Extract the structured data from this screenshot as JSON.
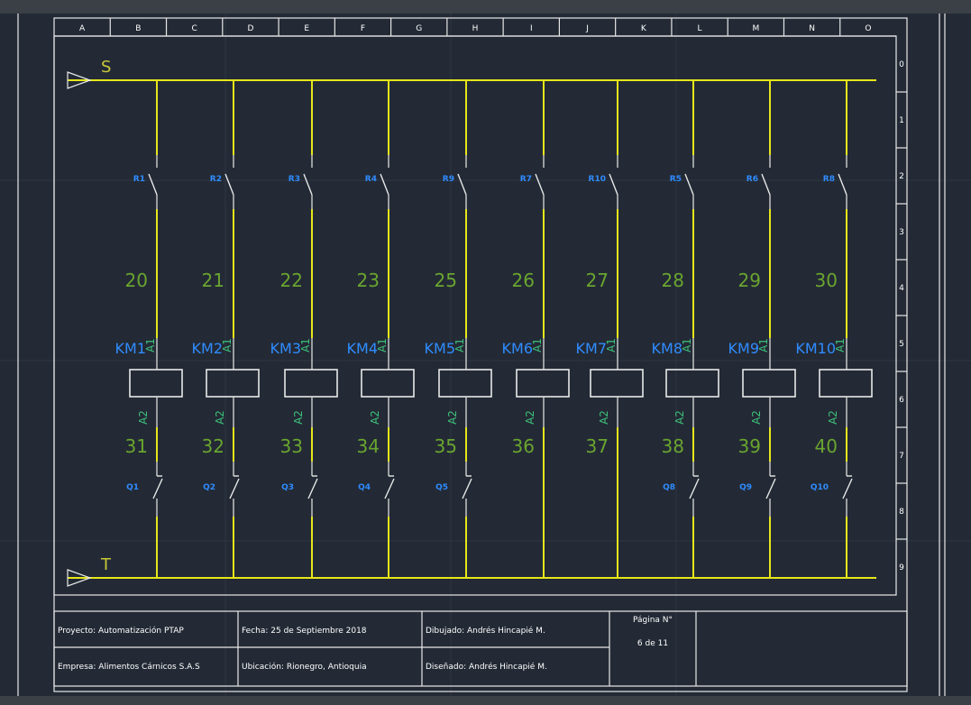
{
  "colors": {
    "background": "#232a35",
    "frame": "#e8e8e8",
    "wire": "#e6e61a",
    "label_blue": "#2f8cff",
    "wire_number_green": "#6aa52f",
    "terminal_green": "#3ec07a"
  },
  "columns": [
    "A",
    "B",
    "C",
    "D",
    "E",
    "F",
    "G",
    "H",
    "I",
    "J",
    "K",
    "L",
    "M",
    "N",
    "O"
  ],
  "rows": [
    "0",
    "1",
    "2",
    "3",
    "4",
    "5",
    "6",
    "7",
    "8",
    "9"
  ],
  "bus": {
    "top_label": "S",
    "bottom_label": "T"
  },
  "branches": [
    {
      "contact": "R1",
      "upper_wire": "20",
      "coil": "KM1",
      "lower_wire": "31",
      "aux": "Q1"
    },
    {
      "contact": "R2",
      "upper_wire": "21",
      "coil": "KM2",
      "lower_wire": "32",
      "aux": "Q2"
    },
    {
      "contact": "R3",
      "upper_wire": "22",
      "coil": "KM3",
      "lower_wire": "33",
      "aux": "Q3"
    },
    {
      "contact": "R4",
      "upper_wire": "23",
      "coil": "KM4",
      "lower_wire": "34",
      "aux": "Q4"
    },
    {
      "contact": "R9",
      "upper_wire": "25",
      "coil": "KM5",
      "lower_wire": "35",
      "aux": "Q5"
    },
    {
      "contact": "R7",
      "upper_wire": "26",
      "coil": "KM6",
      "lower_wire": "36",
      "aux": ""
    },
    {
      "contact": "R10",
      "upper_wire": "27",
      "coil": "KM7",
      "lower_wire": "37",
      "aux": ""
    },
    {
      "contact": "R5",
      "upper_wire": "28",
      "coil": "KM8",
      "lower_wire": "38",
      "aux": "Q8"
    },
    {
      "contact": "R6",
      "upper_wire": "29",
      "coil": "KM9",
      "lower_wire": "39",
      "aux": "Q9"
    },
    {
      "contact": "R8",
      "upper_wire": "30",
      "coil": "KM10",
      "lower_wire": "40",
      "aux": "Q10"
    }
  ],
  "coil_terminals": {
    "top": "A1",
    "bottom": "A2"
  },
  "title_block": {
    "project": "Proyecto:   Automatización PTAP",
    "company": "Empresa:   Alimentos Cárnicos S.A.S",
    "date": "Fecha:   25 de Septiembre  2018",
    "location": "Ubicación:   Rionegro, Antioquia",
    "drawn_by": "Dibujado:   Andrés Hincapié M.",
    "designed_by": "Diseñado:   Andrés Hincapié M.",
    "page_label": "Página N°",
    "page_value": "6 de 11"
  }
}
